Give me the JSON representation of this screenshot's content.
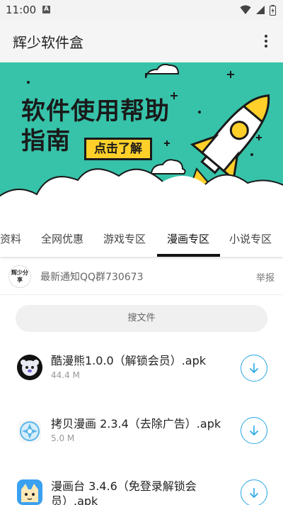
{
  "status_bar": {
    "time": "11:00",
    "notification_badge": "A"
  },
  "app_bar": {
    "title": "辉少软件盒",
    "menu_icon": "more-vertical-icon"
  },
  "banner": {
    "title_line1": "软件使用帮助",
    "title_line2": "指南",
    "cta_label": "点击了解",
    "background_color": "#36c3a9"
  },
  "tabs": {
    "items": [
      "资料",
      "全网优惠",
      "游戏专区",
      "漫画专区",
      "小说专区"
    ],
    "active_index": 3
  },
  "notice": {
    "avatar_text": "辉少分享",
    "text": "最新通知QQ群730673",
    "report_label": "举报"
  },
  "search": {
    "placeholder": "搜文件"
  },
  "files": [
    {
      "name": "酷漫熊1.0.0（解锁会员）.apk",
      "size": "44.4 M",
      "icon": "bear-app-icon"
    },
    {
      "name": "拷贝漫画 2.3.4（去除广告）.apk",
      "size": "5.0 M",
      "icon": "copy-manga-app-icon"
    },
    {
      "name": "漫画台 3.4.6（免登录解锁会员）.apk",
      "size": "",
      "icon": "manhuatai-app-icon"
    }
  ],
  "accent_color": "#29a8e6"
}
